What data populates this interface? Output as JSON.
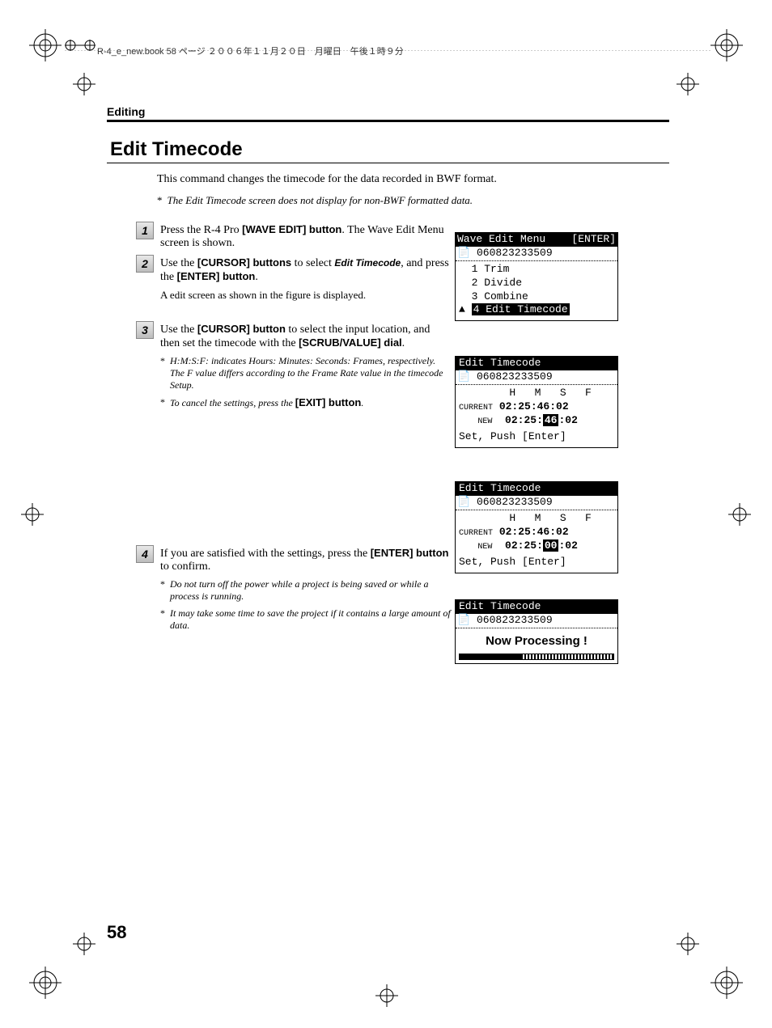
{
  "header": {
    "text": "R-4_e_new.book  58 ページ  ２００６年１１月２０日　月曜日　午後１時９分"
  },
  "section_label": "Editing",
  "page_title": "Edit Timecode",
  "intro": {
    "text": "This command changes the timecode for the data recorded in BWF format.",
    "note": "The Edit Timecode screen does not display for non-BWF formatted data."
  },
  "steps": [
    {
      "num": "1",
      "lines": [
        {
          "t": "plain",
          "v": "Press the R-4 Pro "
        },
        {
          "t": "bold",
          "v": "[WAVE EDIT] button"
        },
        {
          "t": "plain",
          "v": ". The Wave Edit Menu screen is shown."
        }
      ]
    },
    {
      "num": "2",
      "lines": [
        {
          "t": "plain",
          "v": "Use the "
        },
        {
          "t": "bold",
          "v": "[CURSOR] buttons"
        },
        {
          "t": "plain",
          "v": " to select "
        },
        {
          "t": "bold-italic",
          "v": "Edit Timecode"
        },
        {
          "t": "plain",
          "v": ", and press the "
        },
        {
          "t": "bold",
          "v": "[ENTER] button"
        },
        {
          "t": "plain",
          "v": "."
        }
      ],
      "sub": "A edit screen as shown in the figure is displayed."
    },
    {
      "num": "3",
      "lines": [
        {
          "t": "plain",
          "v": "Use the "
        },
        {
          "t": "bold",
          "v": "[CURSOR] button"
        },
        {
          "t": "plain",
          "v": " to select the input location, and then set the timecode with the "
        },
        {
          "t": "bold",
          "v": "[SCRUB/VALUE] dial"
        },
        {
          "t": "plain",
          "v": "."
        }
      ],
      "notes": [
        "H:M:S:F: indicates Hours: Minutes: Seconds: Frames, respectively. The F value differs according to the Frame Rate value in the timecode Setup.",
        {
          "mixed": [
            {
              "t": "plain",
              "v": "To cancel the settings, press the "
            },
            {
              "t": "bold",
              "v": "[EXIT] button"
            },
            {
              "t": "plain",
              "v": "."
            }
          ]
        }
      ]
    },
    {
      "num": "4",
      "lines": [
        {
          "t": "plain",
          "v": "If you are satisfied with the settings, press the "
        },
        {
          "t": "bold",
          "v": "[ENTER] button"
        },
        {
          "t": "plain",
          "v": " to confirm."
        }
      ],
      "notes": [
        "Do not turn off the power while a project is being saved or while a process is running.",
        "It may take some time to save the project if it contains a large amount of data."
      ]
    }
  ],
  "lcds": {
    "menu": {
      "title": "Wave Edit Menu",
      "title_right": "[ENTER]",
      "file": "060823233509",
      "items": [
        {
          "idx": "1",
          "label": "Trim",
          "sel": false
        },
        {
          "idx": "2",
          "label": "Divide",
          "sel": false
        },
        {
          "idx": "3",
          "label": "Combine",
          "sel": false
        },
        {
          "idx": "4",
          "label": "Edit Timecode",
          "sel": true
        }
      ],
      "arrow": "▲"
    },
    "tc1": {
      "title": "Edit Timecode",
      "file": "060823233509",
      "cols": "        H   M   S   F",
      "current_label": "CURRENT",
      "current": "02:25:46:02",
      "new_label": "NEW",
      "new_h": "02",
      "new_m": "25",
      "new_s": "46",
      "new_f": "02",
      "new_sel": "s",
      "hint": "Set, Push [Enter]"
    },
    "tc2": {
      "title": "Edit Timecode",
      "file": "060823233509",
      "cols": "        H   M   S   F",
      "current_label": "CURRENT",
      "current": "02:25:46:02",
      "new_label": "NEW",
      "new_h": "02",
      "new_m": "25",
      "new_s": "00",
      "new_f": "02",
      "new_sel": "s",
      "hint": "Set, Push [Enter]"
    },
    "proc": {
      "title": "Edit Timecode",
      "file": "060823233509",
      "msg": "Now Processing !"
    }
  },
  "page_number": "58"
}
